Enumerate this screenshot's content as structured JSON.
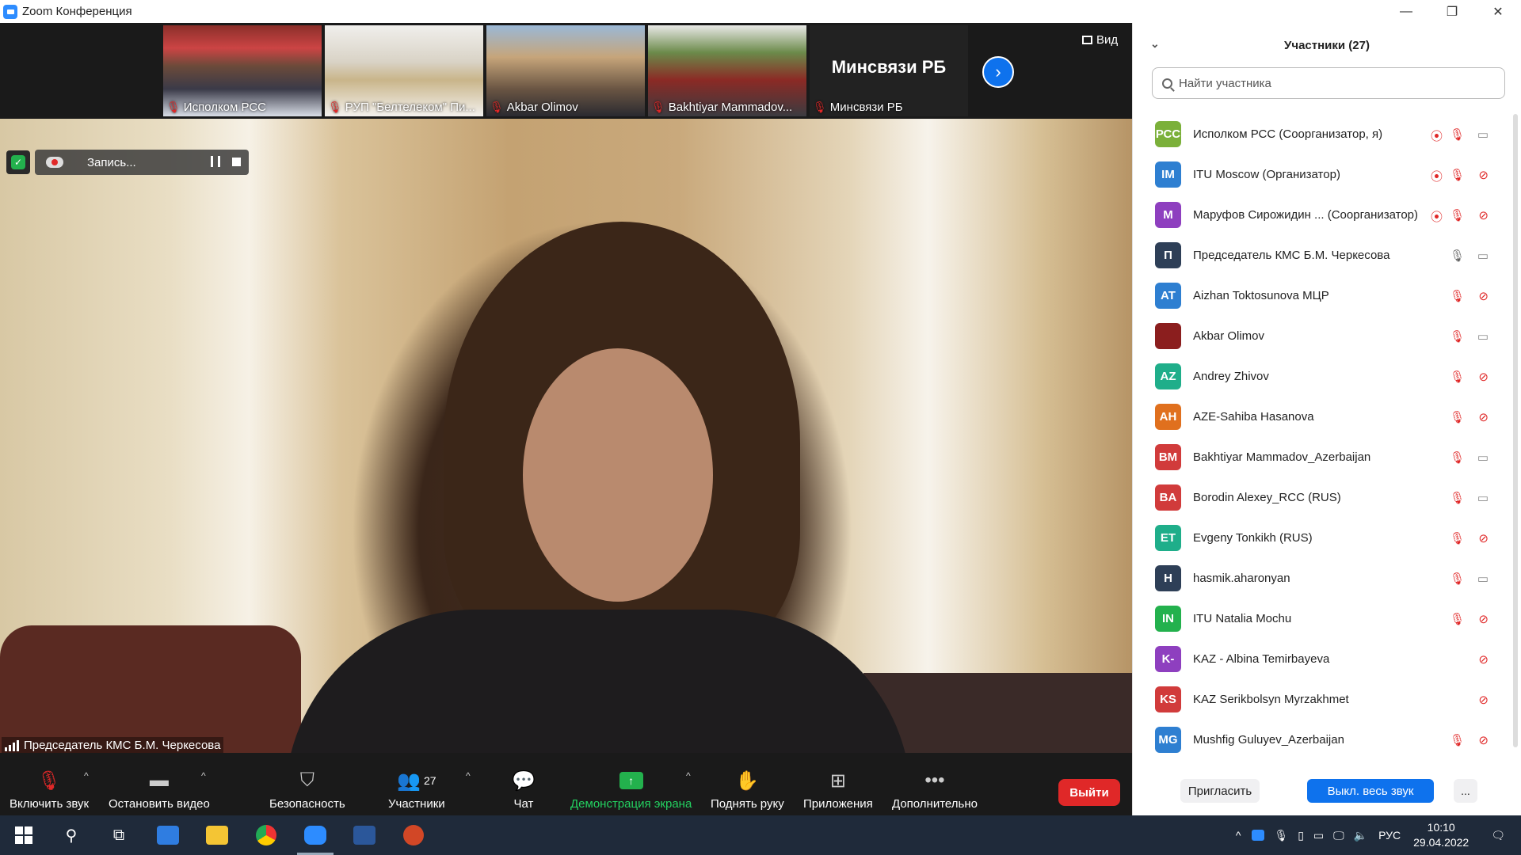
{
  "window": {
    "title": "Zoom Конференция",
    "min": "—",
    "max": "❐",
    "close": "✕"
  },
  "thumbnails": [
    {
      "name": "Исполком РСС"
    },
    {
      "name": "РУП \"Белтелеком\" Пи..."
    },
    {
      "name": "Akbar Olimov"
    },
    {
      "name": "Bakhtiyar Mammadov..."
    },
    {
      "name": "Минсвязи РБ",
      "big": "Минсвязи РБ"
    }
  ],
  "view_label": "Вид",
  "recording": {
    "label": "Запись..."
  },
  "speaker": {
    "name": "Председатель КМС Б.М. Черкесова"
  },
  "toolbar": {
    "unmute": "Включить звук",
    "stop_video": "Остановить видео",
    "security": "Безопасность",
    "participants": "Участники",
    "participants_count": "27",
    "chat": "Чат",
    "share": "Демонстрация экрана",
    "raise_hand": "Поднять руку",
    "apps": "Приложения",
    "more": "Дополнительно",
    "leave": "Выйти"
  },
  "panel": {
    "title": "Участники (27)",
    "search_placeholder": "Найти участника",
    "invite": "Пригласить",
    "mute_all": "Выкл. весь звук",
    "more": "...",
    "participants": [
      {
        "initials": "РСС",
        "color": "#7bb03a",
        "name": "Исполком РСС (Соорганизатор, я)",
        "rec": true,
        "mic": "off",
        "cam": "on"
      },
      {
        "initials": "IM",
        "color": "#2e7fd1",
        "name": "ITU Moscow (Организатор)",
        "rec": true,
        "mic": "off",
        "cam": "off"
      },
      {
        "initials": "M",
        "color": "#8e3fbf",
        "name": "Маруфов Сирожидин ...  (Соорганизатор)",
        "rec": true,
        "mic": "off",
        "cam": "off"
      },
      {
        "initials": "П",
        "color": "#2e3f57",
        "name": "Председатель КМС Б.М. Черкесова",
        "rec": false,
        "mic": "on",
        "cam": "on"
      },
      {
        "initials": "AT",
        "color": "#2e7fd1",
        "name": "Aizhan Toktosunova МЦР",
        "rec": false,
        "mic": "off",
        "cam": "off"
      },
      {
        "initials": "",
        "color": "#8b1e1e",
        "name": "Akbar Olimov",
        "rec": false,
        "mic": "off",
        "cam": "on"
      },
      {
        "initials": "AZ",
        "color": "#1fae8a",
        "name": "Andrey Zhivov",
        "rec": false,
        "mic": "off",
        "cam": "off"
      },
      {
        "initials": "AH",
        "color": "#e0701e",
        "name": "AZE-Sahiba Hasanova",
        "rec": false,
        "mic": "off",
        "cam": "off"
      },
      {
        "initials": "BM",
        "color": "#d13b3b",
        "name": "Bakhtiyar Mammadov_Azerbaijan",
        "rec": false,
        "mic": "off",
        "cam": "on"
      },
      {
        "initials": "BA",
        "color": "#d13b3b",
        "name": "Borodin Alexey_RCC (RUS)",
        "rec": false,
        "mic": "off",
        "cam": "on"
      },
      {
        "initials": "ET",
        "color": "#1fae8a",
        "name": "Evgeny Tonkikh (RUS)",
        "rec": false,
        "mic": "off",
        "cam": "off"
      },
      {
        "initials": "H",
        "color": "#2e3f57",
        "name": "hasmik.aharonyan",
        "rec": false,
        "mic": "off",
        "cam": "on"
      },
      {
        "initials": "IN",
        "color": "#23b14d",
        "name": "ITU Natalia Mochu",
        "rec": false,
        "mic": "off",
        "cam": "off"
      },
      {
        "initials": "K-",
        "color": "#8e3fbf",
        "name": "KAZ - Albina Temirbayeva",
        "rec": false,
        "mic": "",
        "cam": "offonly"
      },
      {
        "initials": "KS",
        "color": "#d13b3b",
        "name": "KAZ Serikbolsyn Myrzakhmet",
        "rec": false,
        "mic": "",
        "cam": "offonly"
      },
      {
        "initials": "MG",
        "color": "#2e7fd1",
        "name": "Mushfig Guluyev_Azerbaijan",
        "rec": false,
        "mic": "off",
        "cam": "off"
      }
    ]
  },
  "taskbar": {
    "language": "РУС",
    "time": "10:10",
    "date": "29.04.2022"
  }
}
